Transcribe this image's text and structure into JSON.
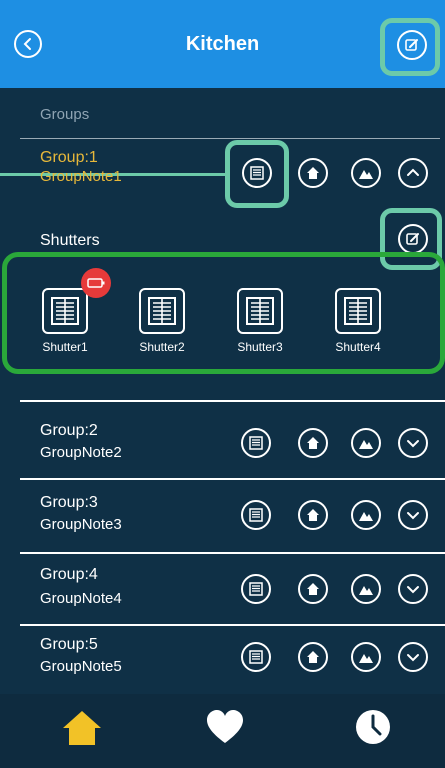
{
  "header": {
    "title": "Kitchen"
  },
  "groups_label": "Groups",
  "shutters_label": "Shutters",
  "group1": {
    "name": "Group:1",
    "note": "GroupNote1",
    "accent": "#e7b83a"
  },
  "shutters": [
    {
      "label": "Shutter1",
      "battery_alert": true
    },
    {
      "label": "Shutter2"
    },
    {
      "label": "Shutter3"
    },
    {
      "label": "Shutter4"
    }
  ],
  "groups": [
    {
      "name": "Group:2",
      "note": "GroupNote2"
    },
    {
      "name": "Group:3",
      "note": "GroupNote3"
    },
    {
      "name": "Group:4",
      "note": "GroupNote4"
    },
    {
      "name": "Group:5",
      "note": "GroupNote5"
    }
  ],
  "tabs": [
    {
      "icon": "home-icon",
      "active": true
    },
    {
      "icon": "heart-icon",
      "active": false
    },
    {
      "icon": "clock-icon",
      "active": false
    }
  ],
  "colors": {
    "header": "#1e8fe3",
    "background": "#0f3046",
    "highlight": "#6ccaa9",
    "group_highlight": "#2aa83a",
    "alert": "#e63a3a",
    "active_tab": "#f2c227"
  }
}
